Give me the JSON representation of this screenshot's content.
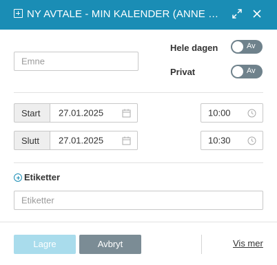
{
  "window": {
    "title": "NY AVTALE - MIN KALENDER (ANNE PRESTHUS)",
    "accent_color": "#1a8db5"
  },
  "subject": {
    "placeholder": "Emne"
  },
  "all_day": {
    "label": "Hele dagen",
    "state": "Av"
  },
  "private": {
    "label": "Privat",
    "state": "Av"
  },
  "start": {
    "label": "Start",
    "date": "27.01.2025",
    "time": "10:00"
  },
  "end": {
    "label": "Slutt",
    "date": "27.01.2025",
    "time": "10:30"
  },
  "tags": {
    "heading": "Etiketter",
    "placeholder": "Etiketter"
  },
  "footer": {
    "save_label": "Lagre",
    "cancel_label": "Avbryt",
    "more_label": "Vis mer"
  }
}
